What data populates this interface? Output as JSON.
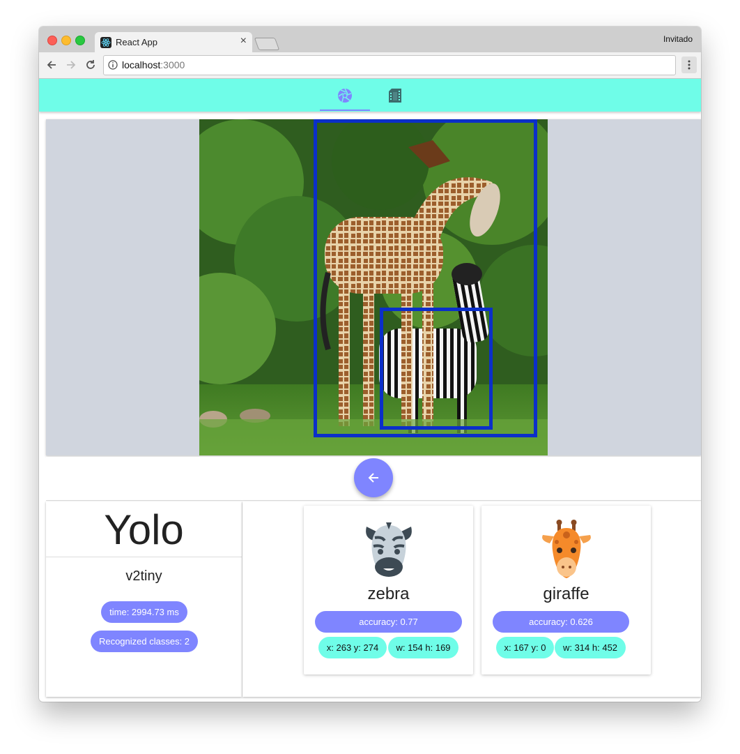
{
  "browser": {
    "tab_title": "React App",
    "tab_close": "×",
    "profile": "Invitado",
    "url_host": "localhost",
    "url_port": ":3000"
  },
  "app_tabs": [
    {
      "icon": "camera-aperture-icon",
      "active": true
    },
    {
      "icon": "film-icon",
      "active": false
    }
  ],
  "colors": {
    "header": "#6ffde8",
    "accent": "#7f85ff",
    "bbox": "#0b2fc9",
    "image_panel": "#d0d5de"
  },
  "image": {
    "description_icon": "photo-giraffe-zebra"
  },
  "model": {
    "name": "Yolo",
    "version": "v2tiny",
    "time": "time: 2994.73 ms",
    "classes": "Recognized classes: 2"
  },
  "detections": [
    {
      "label": "zebra",
      "icon": "zebra-icon",
      "accuracy": "accuracy: 0.77",
      "xy": "x: 263 y: 274",
      "wh": "w: 154 h: 169"
    },
    {
      "label": "giraffe",
      "icon": "giraffe-icon",
      "accuracy": "accuracy: 0.626",
      "xy": "x: 167 y: 0",
      "wh": "w: 314 h: 452"
    }
  ]
}
